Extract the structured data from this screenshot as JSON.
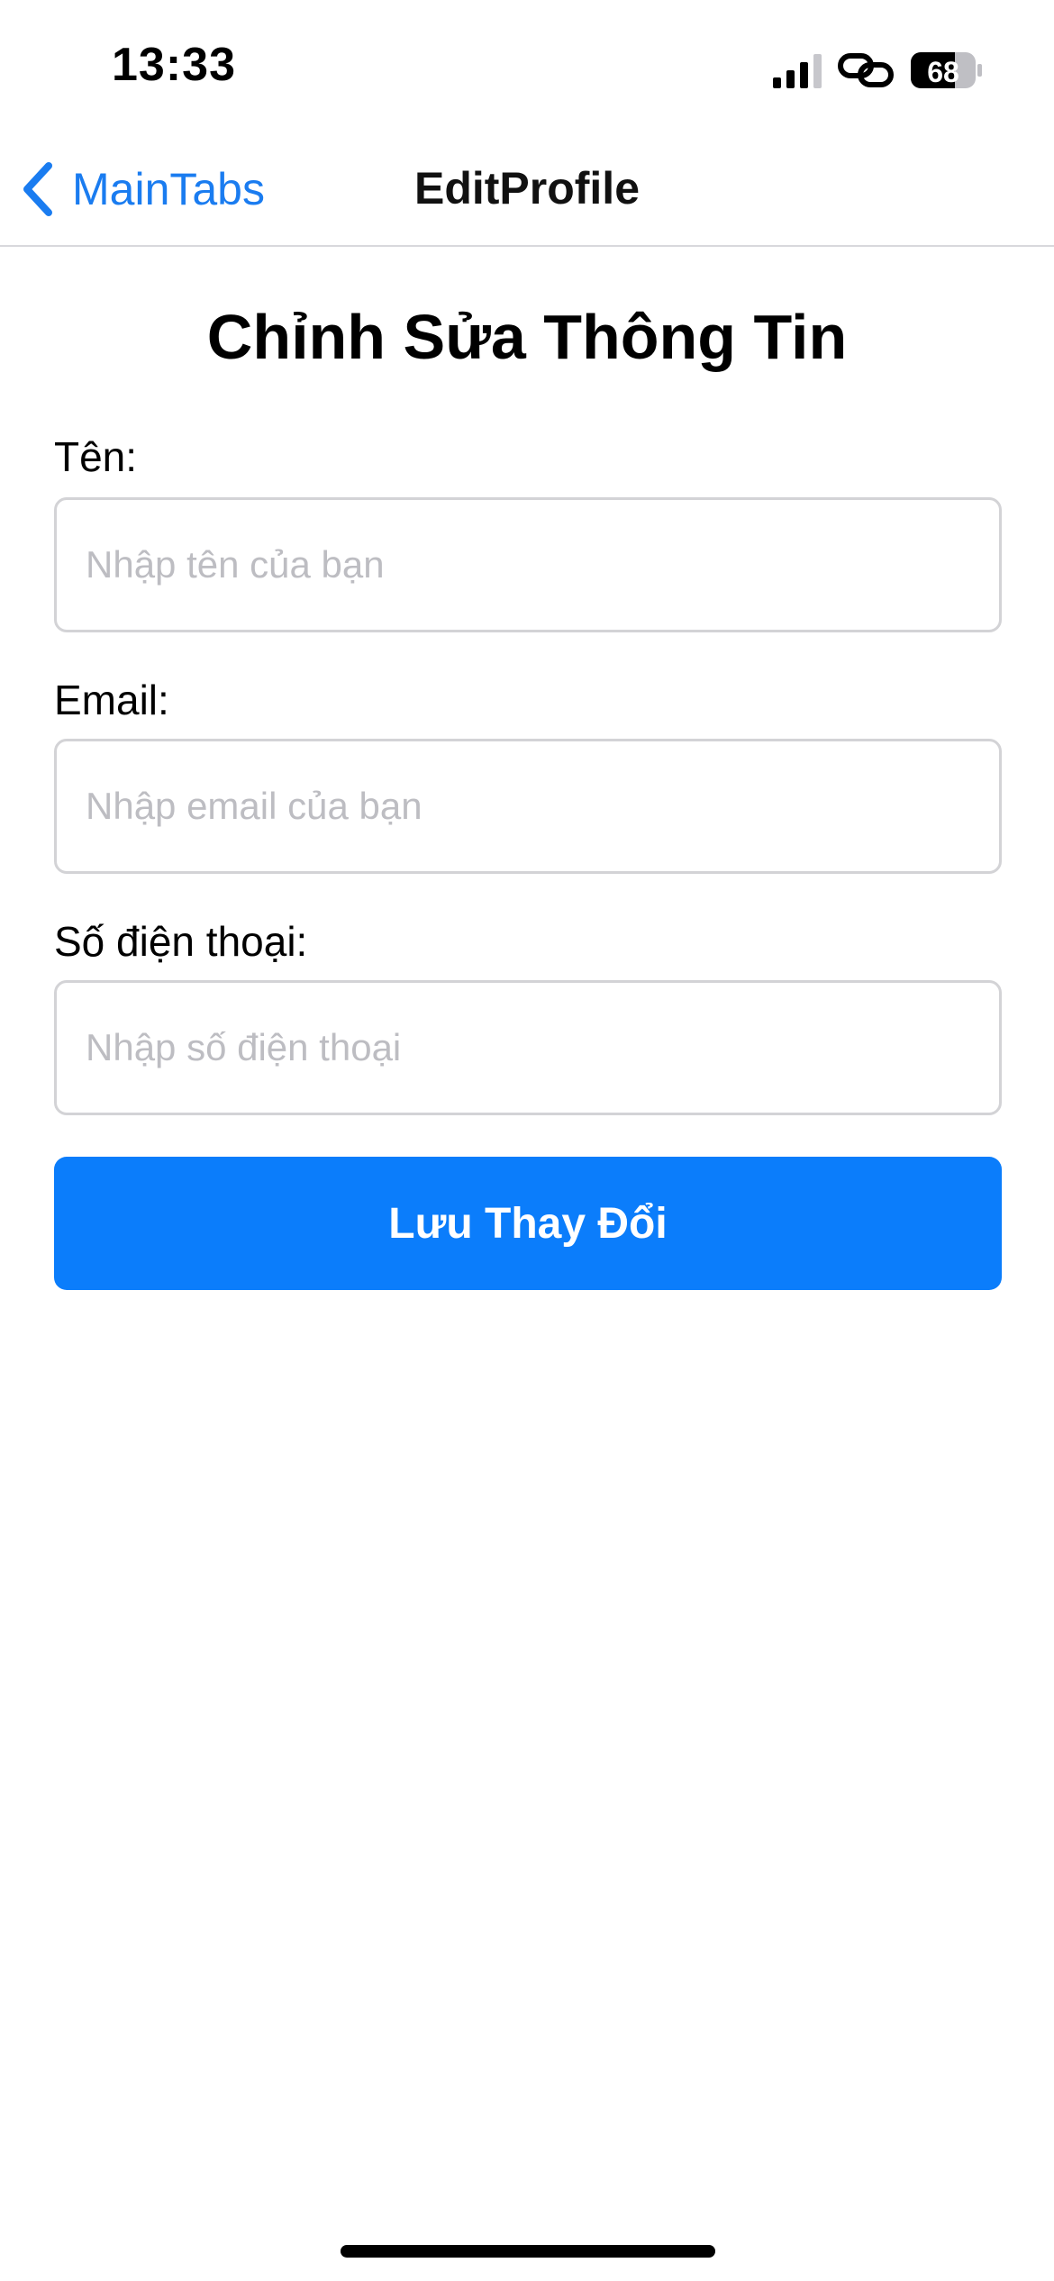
{
  "status_bar": {
    "time": "13:33",
    "battery_level": "68",
    "icons": [
      "signal-icon",
      "link-icon",
      "battery-icon"
    ]
  },
  "nav": {
    "back_label": "MainTabs",
    "title": "EditProfile"
  },
  "form": {
    "title": "Chỉnh Sửa Thông Tin",
    "name": {
      "label": "Tên:",
      "placeholder": "Nhập tên của bạn",
      "value": ""
    },
    "email": {
      "label": "Email:",
      "placeholder": "Nhập email của bạn",
      "value": ""
    },
    "phone": {
      "label": "Số điện thoại:",
      "placeholder": "Nhập số điện thoại",
      "value": ""
    },
    "save_label": "Lưu Thay Đổi"
  },
  "colors": {
    "accent": "#0b7dfb",
    "link": "#1a7cf0",
    "placeholder": "#bdbdc2",
    "border": "#d3d3d6"
  }
}
